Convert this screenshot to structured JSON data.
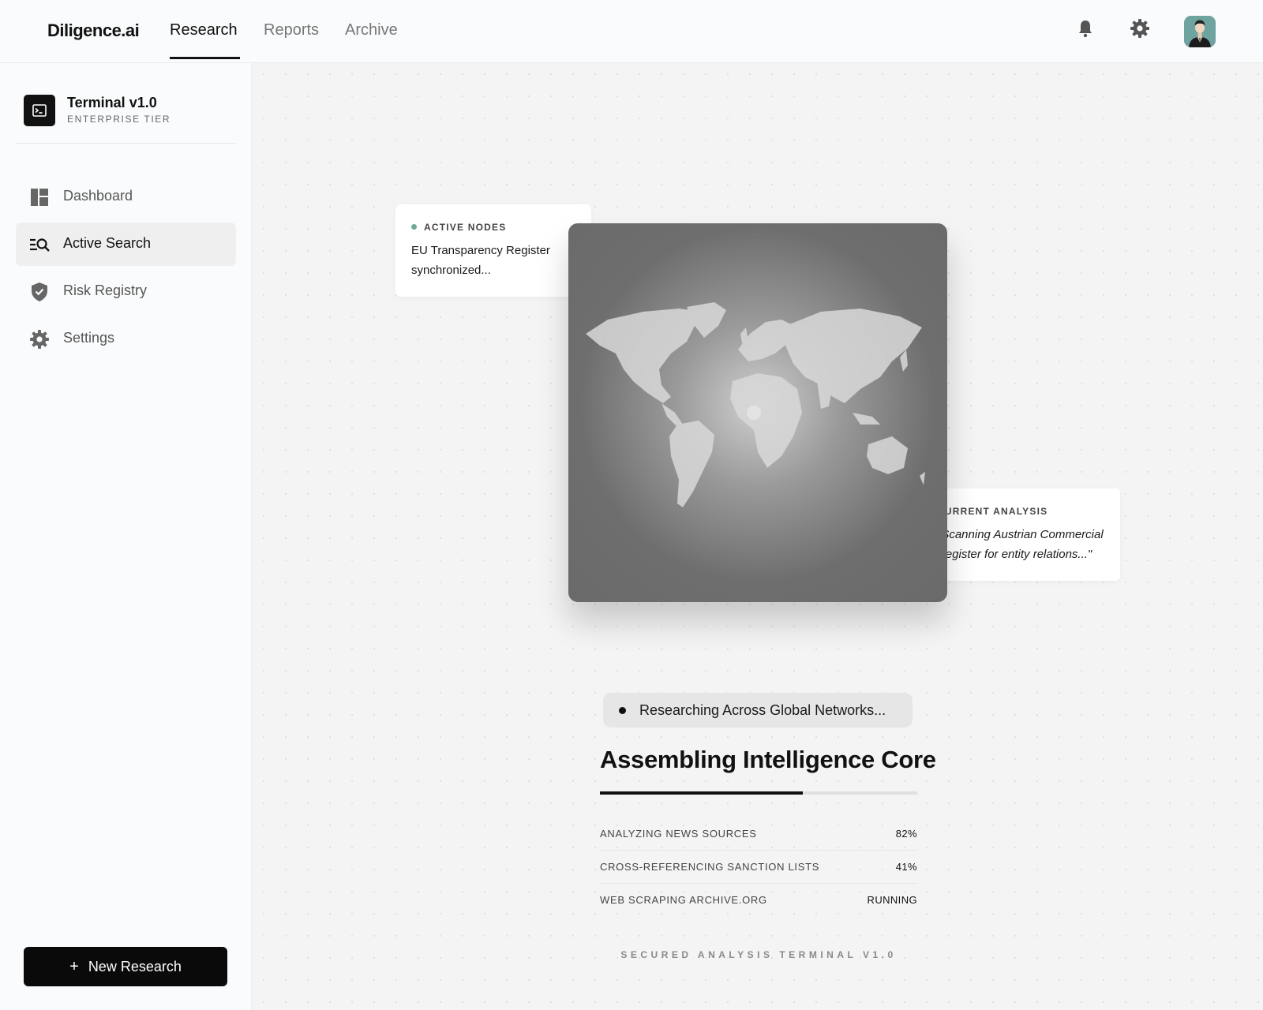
{
  "app": {
    "logo": "Diligence.ai",
    "tabs": [
      {
        "label": "Research",
        "active": true
      },
      {
        "label": "Reports",
        "active": false
      },
      {
        "label": "Archive",
        "active": false
      }
    ],
    "icons": [
      "bell-icon",
      "gear-icon"
    ]
  },
  "sidebar": {
    "brand_name": "Terminal v1.0",
    "brand_tier": "ENTERPRISE TIER",
    "items": [
      {
        "label": "Dashboard",
        "icon": "dashboard-icon",
        "active": false
      },
      {
        "label": "Active Search",
        "icon": "search-list-icon",
        "active": true
      },
      {
        "label": "Risk Registry",
        "icon": "shield-icon",
        "active": false
      },
      {
        "label": "Settings",
        "icon": "gear-icon",
        "active": false
      }
    ],
    "new_button": "New Research"
  },
  "main": {
    "active_nodes": {
      "title": "ACTIVE NODES",
      "text": "EU Transparency Register synchronized..."
    },
    "current_analysis": {
      "title": "CURRENT ANALYSIS",
      "text": "\"Scanning Austrian Commercial Register for entity relations...\""
    },
    "status": "Researching Across Global Networks...",
    "headline": "Assembling Intelligence Core",
    "progress": 0.64,
    "tasks": [
      {
        "label": "ANALYZING NEWS SOURCES",
        "value": "82%"
      },
      {
        "label": "CROSS-REFERENCING SANCTION LISTS",
        "value": "41%"
      },
      {
        "label": "WEB SCRAPING ARCHIVE.ORG",
        "value": "RUNNING"
      }
    ],
    "footer": "SECURED ANALYSIS TERMINAL V1.0"
  },
  "colors": {
    "accent": "#0a0a0a",
    "node_dot": "#6fa89a",
    "avatar_bg": "#6fa3a0"
  }
}
